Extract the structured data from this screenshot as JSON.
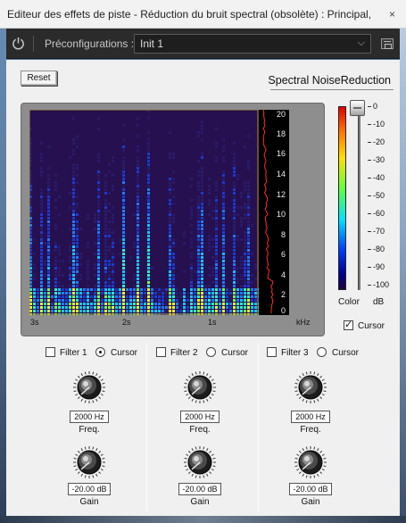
{
  "window": {
    "title": "Editeur des effets de piste - Réduction du bruit spectral (obsolète) : Principal, e...",
    "close_glyph": "×"
  },
  "toolbar": {
    "power_icon": "power-icon",
    "presets_label": "Préconfigurations :",
    "preset_value": "Init 1",
    "dropdown_glyph": "⌵"
  },
  "plugin": {
    "reset_label": "Reset",
    "name": "Spectral NoiseReduction"
  },
  "spectrogram": {
    "y_ticks": [
      "20",
      "18",
      "16",
      "14",
      "12",
      "10",
      "8",
      "6",
      "4",
      "2",
      "0"
    ],
    "x_labels": [
      "3s",
      "2s",
      "1s",
      "kHz"
    ]
  },
  "color_scale": {
    "db_ticks": [
      "0",
      "-10",
      "-20",
      "-30",
      "-40",
      "-50",
      "-60",
      "-70",
      "-80",
      "-90",
      "-100"
    ],
    "color_label": "Color",
    "db_label": "dB",
    "threshold_fraction": 0.0,
    "cursor_label": "Cursor",
    "cursor_checked": true
  },
  "filters": [
    {
      "label": "Filter 1",
      "enabled": false,
      "cursor_label": "Cursor",
      "cursor_selected": true,
      "freq": "2000 Hz",
      "freq_label": "Freq.",
      "gain": "-20.00 dB",
      "gain_label": "Gain"
    },
    {
      "label": "Filter 2",
      "enabled": false,
      "cursor_label": "Cursor",
      "cursor_selected": false,
      "freq": "2000 Hz",
      "freq_label": "Freq.",
      "gain": "-20.00 dB",
      "gain_label": "Gain"
    },
    {
      "label": "Filter 3",
      "enabled": false,
      "cursor_label": "Cursor",
      "cursor_selected": false,
      "freq": "2000 Hz",
      "freq_label": "Freq.",
      "gain": "-20.00 dB",
      "gain_label": "Gain"
    }
  ],
  "colors": {
    "toolbar_bg": "#2b2b2b",
    "panel_bg": "#f0f0f0",
    "spectrum_bg": "#26104f",
    "trace": "#ff2a2a"
  }
}
